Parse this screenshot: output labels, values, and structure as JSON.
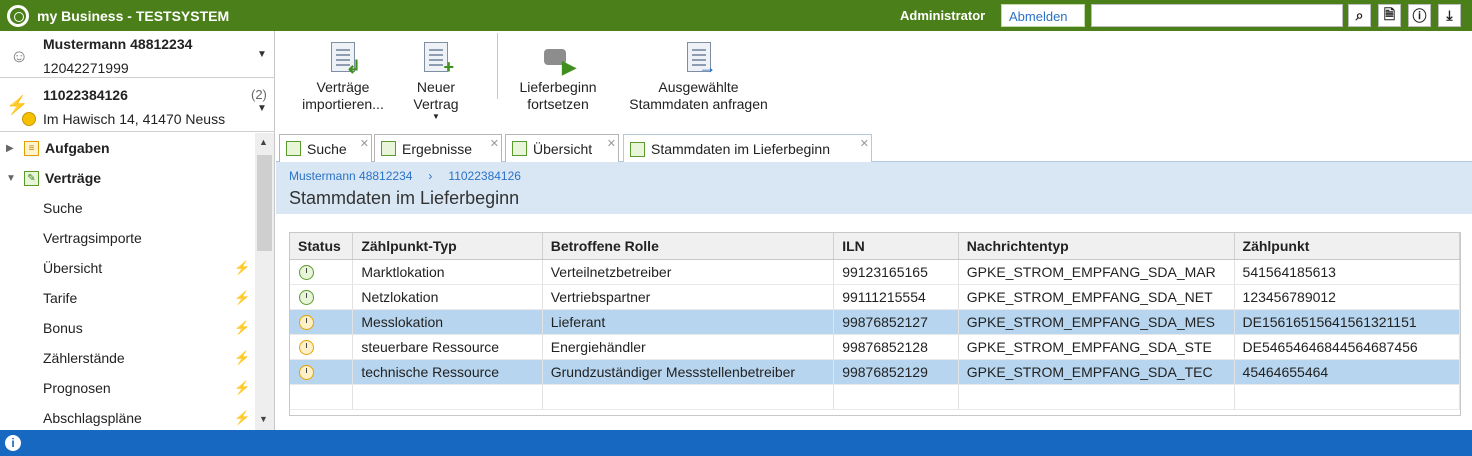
{
  "app": {
    "title": "my Business - TESTSYSTEM"
  },
  "header": {
    "user": "Administrator",
    "logout_label": "Abmelden",
    "search_value": "",
    "icons": [
      "search-icon",
      "export-icon",
      "info-icon",
      "download-icon"
    ]
  },
  "customer": {
    "name": "Mustermann 48812234",
    "number": "12042271999"
  },
  "contract": {
    "number": "11022384126",
    "count": "(2)",
    "address": "Im Hawisch 14, 41470 Neuss"
  },
  "tree": {
    "aufgaben": "Aufgaben",
    "vertraege": "Verträge",
    "items": [
      {
        "label": "Suche",
        "bolt": false
      },
      {
        "label": "Vertragsimporte",
        "bolt": false
      },
      {
        "label": "Übersicht",
        "bolt": true
      },
      {
        "label": "Tarife",
        "bolt": true
      },
      {
        "label": "Bonus",
        "bolt": true
      },
      {
        "label": "Zählerstände",
        "bolt": true
      },
      {
        "label": "Prognosen",
        "bolt": true
      },
      {
        "label": "Abschlagspläne",
        "bolt": true
      }
    ]
  },
  "toolbar": {
    "import_l1": "Verträge",
    "import_l2": "importieren...",
    "new_l1": "Neuer",
    "new_l2": "Vertrag",
    "resume_l1": "Lieferbeginn",
    "resume_l2": "fortsetzen",
    "request_l1": "Ausgewählte",
    "request_l2": "Stammdaten anfragen"
  },
  "tabs": [
    "Suche",
    "Ergebnisse",
    "Übersicht",
    "Stammdaten im Lieferbeginn"
  ],
  "breadcrumb": {
    "customer": "Mustermann 48812234",
    "separator": "›",
    "contract": "11022384126"
  },
  "page_title": "Stammdaten im Lieferbeginn",
  "table": {
    "columns": [
      "Status",
      "Zählpunkt-Typ",
      "Betroffene Rolle",
      "ILN",
      "Nachrichtentyp",
      "Zählpunkt"
    ],
    "rows": [
      {
        "status": "ok",
        "typ": "Marktlokation",
        "rolle": "Verteilnetzbetreiber",
        "iln": "99123165165",
        "nachricht": "GPKE_STROM_EMPFANG_SDA_MAR",
        "zp": "541564185613",
        "selected": false
      },
      {
        "status": "ok",
        "typ": "Netzlokation",
        "rolle": "Vertriebspartner",
        "iln": "99111215554",
        "nachricht": "GPKE_STROM_EMPFANG_SDA_NET",
        "zp": "123456789012",
        "selected": false
      },
      {
        "status": "pending",
        "typ": "Messlokation",
        "rolle": "Lieferant",
        "iln": "99876852127",
        "nachricht": "GPKE_STROM_EMPFANG_SDA_MES",
        "zp": "DE15616515641561321151",
        "selected": true
      },
      {
        "status": "pending",
        "typ": "steuerbare Ressource",
        "rolle": "Energiehändler",
        "iln": "99876852128",
        "nachricht": "GPKE_STROM_EMPFANG_SDA_STE",
        "zp": "DE54654646844564687456",
        "selected": false
      },
      {
        "status": "pending",
        "typ": "technische Ressource",
        "rolle": "Grundzuständiger Messstellenbetreiber",
        "iln": "99876852129",
        "nachricht": "GPKE_STROM_EMPFANG_SDA_TEC",
        "zp": "45464655464",
        "selected": true
      }
    ]
  },
  "colors": {
    "title_green": "#4b7f1a",
    "footer_blue": "#1668c0",
    "strip_blue": "#d8e7f3",
    "selected_row": "#b7d5ee"
  }
}
